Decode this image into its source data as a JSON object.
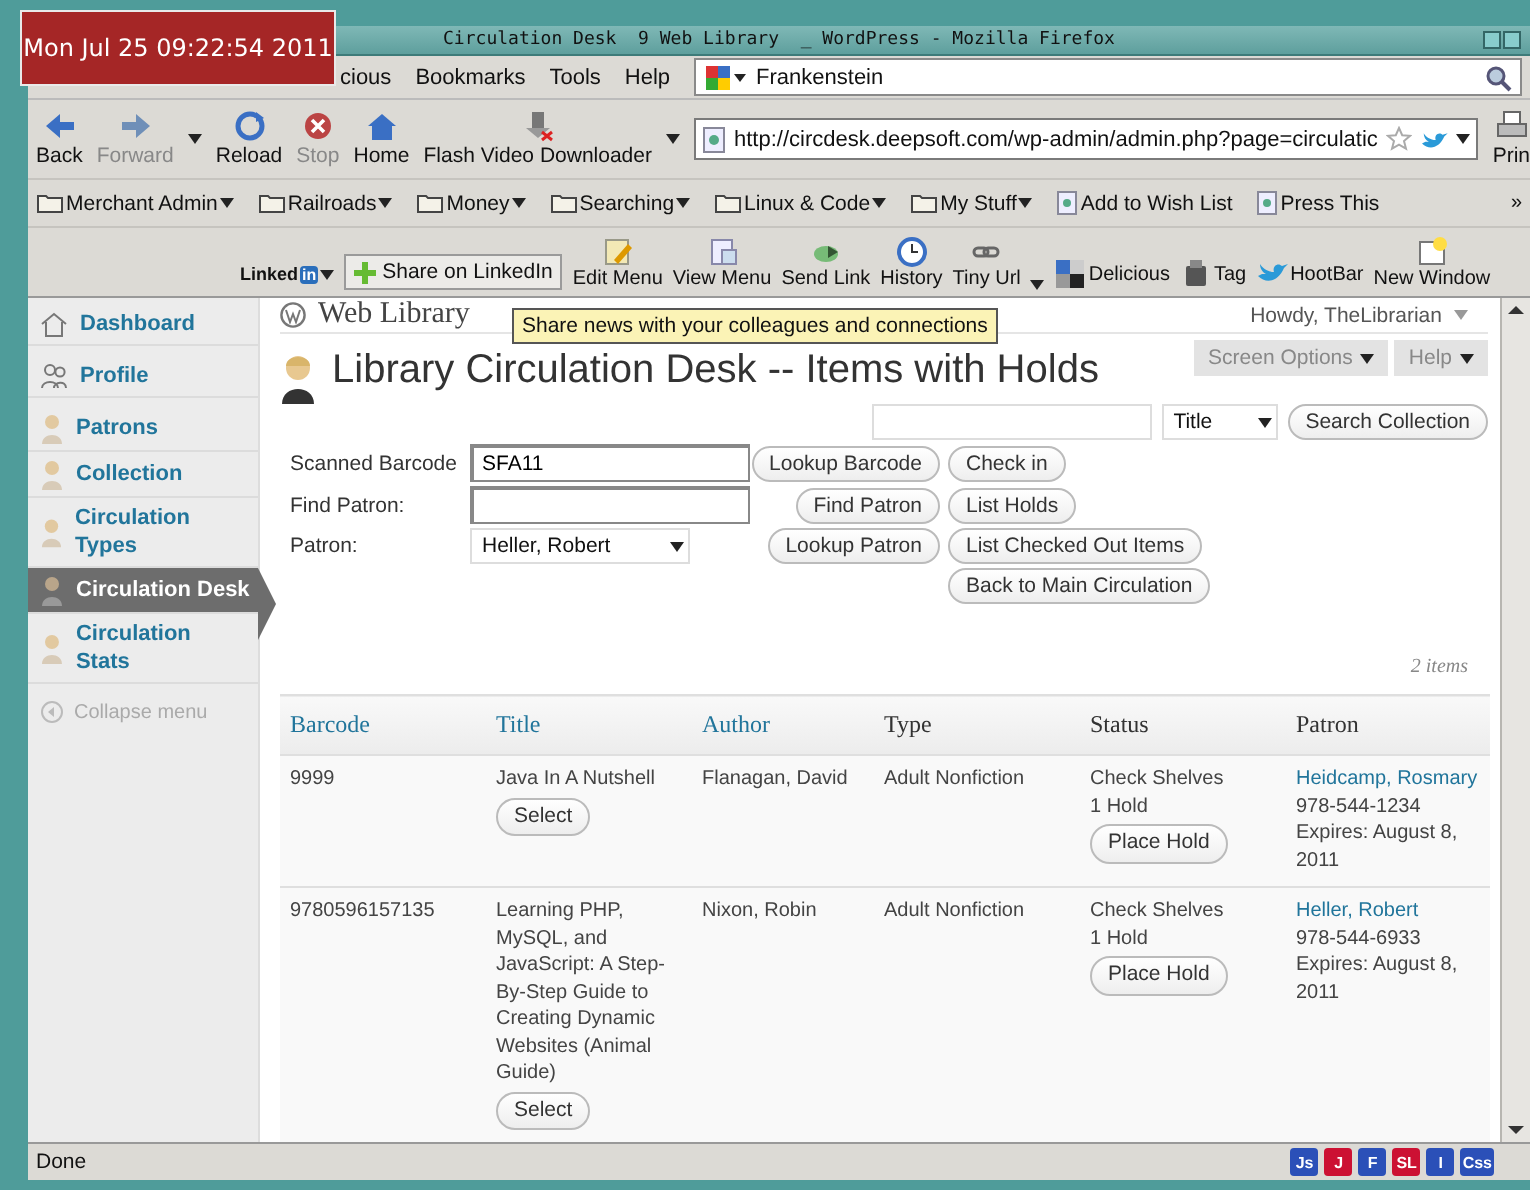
{
  "window": {
    "title": "Circulation Desk  9 Web Library  _ WordPress - Mozilla Firefox"
  },
  "clock": "Mon Jul 25 09:22:54 2011",
  "menu": [
    {
      "label": "cious"
    },
    {
      "label": "Bookmarks"
    },
    {
      "label": "Tools"
    },
    {
      "label": "Help"
    }
  ],
  "web_search": {
    "value": "Frankenstein"
  },
  "nav_buttons": [
    {
      "label": "Back",
      "kind": "back",
      "disabled": false
    },
    {
      "label": "Forward",
      "kind": "forward",
      "disabled": true
    },
    {
      "label": "Reload",
      "kind": "reload",
      "disabled": false
    },
    {
      "label": "Stop",
      "kind": "stop",
      "disabled": true
    },
    {
      "label": "Home",
      "kind": "home",
      "disabled": false
    },
    {
      "label": "Flash Video Downloader",
      "kind": "download",
      "disabled": false
    }
  ],
  "address": {
    "value": "http://circdesk.deepsoft.com/wp-admin/admin.php?page=circulatic"
  },
  "print_label": "Prin",
  "bookmarks": [
    {
      "label": "Merchant Admin",
      "kind": "folder"
    },
    {
      "label": "Railroads",
      "kind": "folder"
    },
    {
      "label": "Money",
      "kind": "folder"
    },
    {
      "label": "Searching",
      "kind": "folder"
    },
    {
      "label": "Linux & Code",
      "kind": "folder"
    },
    {
      "label": "My Stuff",
      "kind": "folder"
    },
    {
      "label": "Add to Wish List",
      "kind": "page"
    },
    {
      "label": "Press This",
      "kind": "page"
    }
  ],
  "bookmarks_overflow": "»",
  "addon_bar": {
    "brand": "Linked",
    "brand_badge": "in",
    "share": "Share on LinkedIn",
    "items": [
      {
        "label": "Edit Menu",
        "kind": "edit"
      },
      {
        "label": "View Menu",
        "kind": "view"
      },
      {
        "label": "Send Link",
        "kind": "link"
      },
      {
        "label": "History",
        "kind": "clock"
      },
      {
        "label": "Tiny Url",
        "kind": "chain"
      },
      {
        "label": "Delicious",
        "kind": "squares"
      },
      {
        "label": "Tag",
        "kind": "tag"
      },
      {
        "label": "HootBar",
        "kind": "bird"
      },
      {
        "label": "New Window",
        "kind": "window"
      }
    ]
  },
  "tooltip": "Share news with your colleagues and connections",
  "sidebar": {
    "items": [
      {
        "label": "Dashboard",
        "kind": "home",
        "selected": false
      },
      {
        "label": "Profile",
        "kind": "users",
        "selected": false
      },
      {
        "label": "Patrons",
        "kind": "person",
        "selected": false
      },
      {
        "label": "Collection",
        "kind": "person",
        "selected": false
      },
      {
        "label": "Circulation Types",
        "kind": "person",
        "selected": false
      },
      {
        "label": "Circulation Desk",
        "kind": "person",
        "selected": true
      },
      {
        "label": "Circulation Stats",
        "kind": "person",
        "selected": false
      }
    ],
    "collapse": "Collapse menu"
  },
  "header": {
    "site": "Web Library",
    "howdy": "Howdy, TheLibrarian",
    "screen_options": "Screen Options",
    "help": "Help"
  },
  "page_title": "Library Circulation Desk -- Items with Holds",
  "collection_search": {
    "field_by": "Title",
    "button": "Search Collection"
  },
  "form": {
    "fields": [
      {
        "label": "Scanned Barcode",
        "value": "SFA11",
        "kind": "text"
      },
      {
        "label": "Find Patron:",
        "kind": "text"
      },
      {
        "label": "Patron:",
        "value": "Heller, Robert",
        "kind": "select"
      }
    ],
    "buttons_left": [
      "Lookup Barcode",
      "Find Patron",
      "Lookup Patron"
    ],
    "buttons_right": [
      "Check in",
      "List Holds",
      "List Checked Out Items",
      "Back to Main Circulation"
    ]
  },
  "table": {
    "count": "2 items",
    "columns": [
      {
        "label": "Barcode",
        "sortable": true
      },
      {
        "label": "Title",
        "sortable": true
      },
      {
        "label": "Author",
        "sortable": true
      },
      {
        "label": "Type",
        "sortable": false
      },
      {
        "label": "Status",
        "sortable": false
      },
      {
        "label": "Patron",
        "sortable": false
      }
    ],
    "rows": [
      {
        "barcode": "9999",
        "title": "Java In A Nutshell",
        "select": "Select",
        "author": "Flanagan, David",
        "type": "Adult Nonfiction",
        "status": "Check Shelves",
        "holds": "1 Hold",
        "hold_button": "Place Hold",
        "patron": "Heidcamp, Rosmary",
        "phone": "978-544-1234",
        "expires": "Expires: August 8, 2011"
      },
      {
        "barcode": "9780596157135",
        "title": "Learning PHP, MySQL, and JavaScript: A Step-By-Step Guide to Creating Dynamic Websites (Animal Guide)",
        "select": "Select",
        "author": "Nixon, Robin",
        "type": "Adult Nonfiction",
        "status": "Check Shelves",
        "holds": "1 Hold",
        "hold_button": "Place Hold",
        "patron": "Heller, Robert",
        "phone": "978-544-6933",
        "expires": "Expires: August 8, 2011"
      }
    ]
  },
  "status_bar": {
    "text": "Done",
    "badges": [
      {
        "label": "Js",
        "color": "#2b50b8"
      },
      {
        "label": "J",
        "color": "#cc1133"
      },
      {
        "label": "F",
        "color": "#2b50b8"
      },
      {
        "label": "SL",
        "color": "#cc1133"
      },
      {
        "label": "I",
        "color": "#2b50b8"
      },
      {
        "label": "Css",
        "color": "#2b50b8"
      }
    ]
  }
}
